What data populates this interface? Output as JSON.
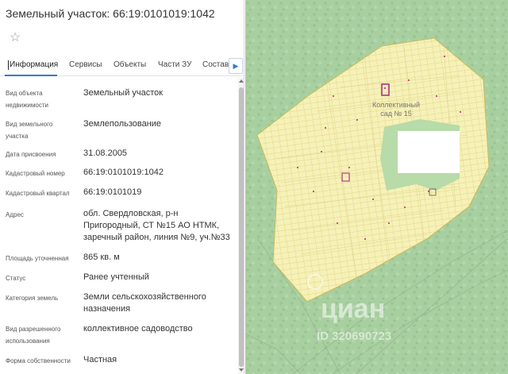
{
  "header": {
    "title": "Земельный участок: 66:19:0101019:1042"
  },
  "favorite": {
    "icon": "star-icon"
  },
  "tabs": [
    {
      "label": "Информация",
      "active": true
    },
    {
      "label": "Сервисы"
    },
    {
      "label": "Объекты"
    },
    {
      "label": "Части ЗУ"
    },
    {
      "label": "Состав"
    }
  ],
  "tab_scroll": {
    "icon": "chevron-right-icon"
  },
  "fields": [
    {
      "label": "Вид объекта недвижимости",
      "value": "Земельный участок"
    },
    {
      "label": "Вид земельного участка",
      "value": "Землепользование"
    },
    {
      "label": "Дата присвоения",
      "value": "31.08.2005"
    },
    {
      "label": "Кадастровый номер",
      "value": "66:19:0101019:1042"
    },
    {
      "label": "Кадастровый квартал",
      "value": "66:19:0101019"
    },
    {
      "label": "Адрес",
      "value": "обл. Свердловская, р-н Пригородный, СТ №15 АО НТМК, заречный район, линия №9, уч.№33"
    },
    {
      "label": "Площадь уточненная",
      "value": "865 кв. м"
    },
    {
      "label": "Статус",
      "value": "Ранее учтенный"
    },
    {
      "label": "Категория земель",
      "value": "Земли сельскохозяйственного назначения"
    },
    {
      "label": "Вид разрешенного использования",
      "value": "коллективное садоводство"
    },
    {
      "label": "Форма собственности",
      "value": "Частная"
    }
  ],
  "map": {
    "label_line1": "Коллективный",
    "label_line2": "сад № 15",
    "watermark_text": "циан",
    "watermark_id": "ID 320690723",
    "colors": {
      "forest": "#a8cfa0",
      "garden": "#f6f1b8",
      "plot_border": "#d9cf78",
      "highlight": "#a8338a"
    }
  }
}
